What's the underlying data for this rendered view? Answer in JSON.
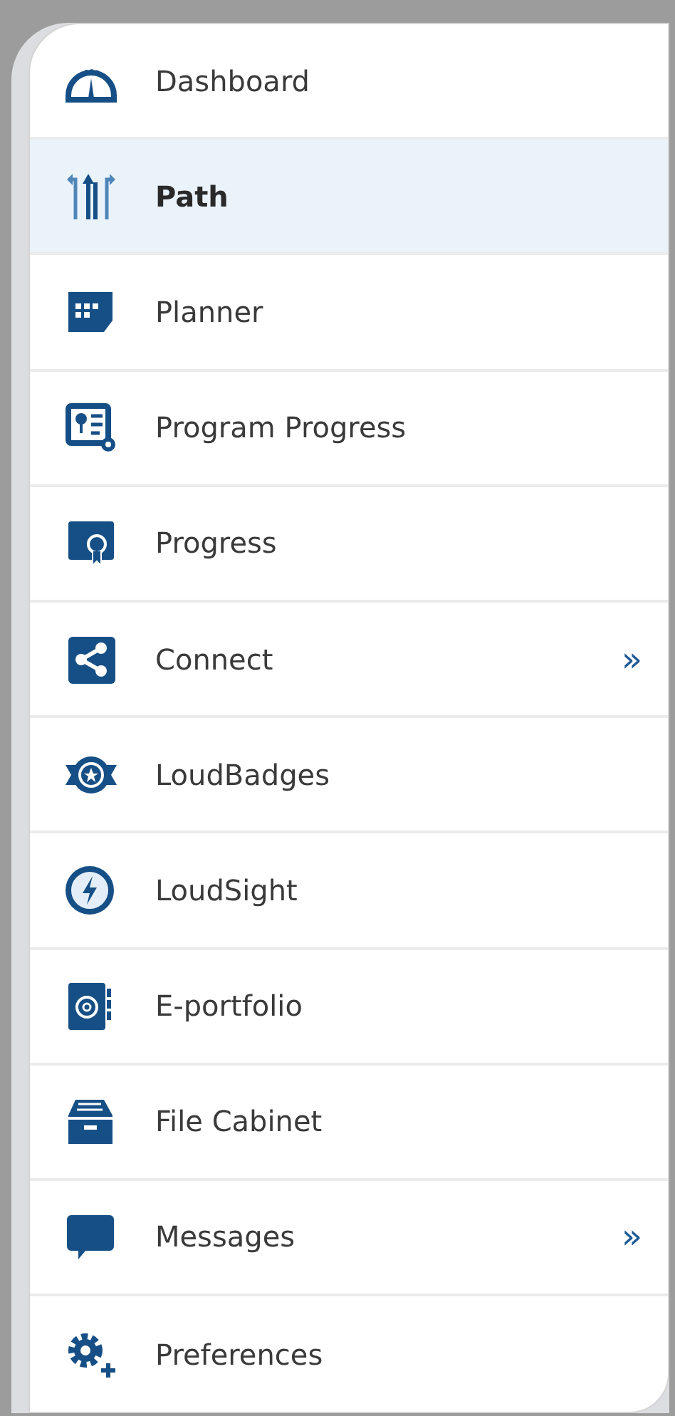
{
  "menu": {
    "items": [
      {
        "label": "Dashboard",
        "selected": false
      },
      {
        "label": "Path",
        "selected": true
      },
      {
        "label": "Planner",
        "selected": false
      },
      {
        "label": "Program Progress",
        "selected": false
      },
      {
        "label": "Progress",
        "selected": false
      },
      {
        "label": "Connect",
        "selected": false,
        "chevron": "»"
      },
      {
        "label": "LoudBadges",
        "selected": false
      },
      {
        "label": "LoudSight",
        "selected": false
      },
      {
        "label": "E-portfolio",
        "selected": false
      },
      {
        "label": "File Cabinet",
        "selected": false
      },
      {
        "label": "Messages",
        "selected": false,
        "chevron": "»"
      },
      {
        "label": "Preferences",
        "selected": false
      }
    ]
  }
}
